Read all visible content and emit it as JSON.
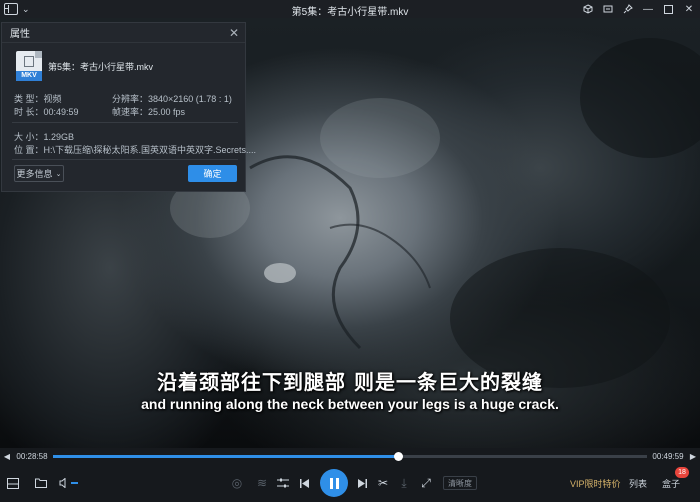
{
  "window": {
    "title": "第5集：考古小行星带.mkv",
    "menu_icon": "player-logo-icon",
    "buttons": [
      "cube-icon",
      "minimize-to-tray-icon",
      "pin-icon",
      "minimize-icon",
      "restore-icon",
      "close-icon"
    ]
  },
  "subtitles": {
    "zh": "沿着颈部往下到腿部 则是一条巨大的裂缝",
    "en": "and running along the neck between your legs is a huge crack."
  },
  "properties": {
    "title": "属性",
    "file_badge": "MKV",
    "file_name": "第5集：考古小行星带.mkv",
    "type": "类 型：视频",
    "duration": "时 长：00:49:59",
    "resolution": "分辨率：3840×2160 (1.78 : 1)",
    "fps": "帧速率：25.00 fps",
    "size": "大 小：1.29GB",
    "location": "位 置：H:\\下载压缩\\探秘太阳系.国英双语中英双字.Secrets....",
    "more_label": "更多信息",
    "ok_label": "确定"
  },
  "progress": {
    "current": "00:28:58",
    "total": "00:49:59",
    "fraction": 0.58
  },
  "controls": {
    "quality_label": "清晰度",
    "vip_label": "VIP限时特价",
    "list_label": "列表",
    "box_label": "盒子",
    "box_badge": "18"
  },
  "colors": {
    "accent": "#2f8fe8",
    "vip": "#d6b36a",
    "badge": "#e8453c"
  }
}
